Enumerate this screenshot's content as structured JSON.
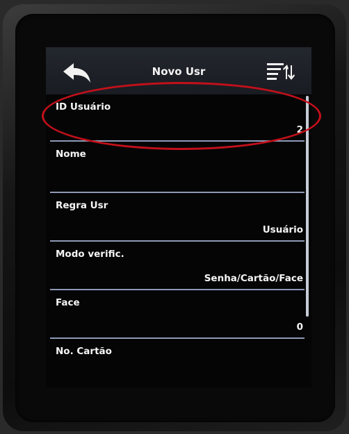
{
  "header": {
    "title": "Novo Usr",
    "back_icon": "back-arrow-icon",
    "menu_icon": "sort-menu-icon"
  },
  "fields": [
    {
      "label": "ID Usuário",
      "value": "2"
    },
    {
      "label": "Nome",
      "value": ""
    },
    {
      "label": "Regra Usr",
      "value": "Usuário"
    },
    {
      "label": "Modo verific.",
      "value": "Senha/Cartão/Face"
    },
    {
      "label": "Face",
      "value": "0"
    },
    {
      "label": "No. Cartão",
      "value": ""
    }
  ],
  "colors": {
    "screen_bg": "#050506",
    "divider": "#8e9ab6",
    "text": "#f5f5f5",
    "highlight": "#c4101a"
  }
}
